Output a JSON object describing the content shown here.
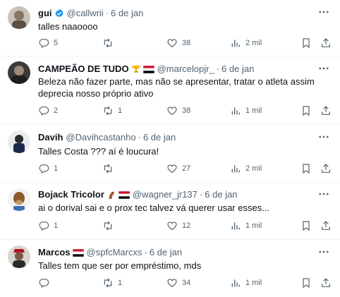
{
  "tweets": [
    {
      "name": "gui",
      "verified": true,
      "handle": "@callwrii",
      "sep": "·",
      "time": "6 de jan",
      "text": "talles naaoooo",
      "replies": "5",
      "retweets": "",
      "likes": "38",
      "views": "2 mil"
    },
    {
      "name": "CAMPEÃO DE TUDO",
      "emojis": [
        "trophy-emoji",
        "flag-emoji"
      ],
      "handle": "@marcelopjr_",
      "sep": "·",
      "time": "6 de jan",
      "text": "Beleza não fazer parte, mas não se apresentar, tratar o atleta assim deprecia nosso próprio ativo",
      "replies": "2",
      "retweets": "1",
      "likes": "38",
      "views": "1 mil"
    },
    {
      "name": "Davih",
      "handle": "@Davihcastanho",
      "sep": "·",
      "time": "6 de jan",
      "text": "Talles Costa ??? aí é loucura!",
      "replies": "1",
      "retweets": "",
      "likes": "27",
      "views": "2 mil"
    },
    {
      "name": "Bojack Tricolor",
      "emojis": [
        "horse-emoji",
        "flag-emoji"
      ],
      "handle": "@wagner_jr137",
      "sep": "·",
      "time": "6 de jan",
      "text": "ai o dorival sai e o prox tec talvez vá querer usar esses...",
      "replies": "1",
      "retweets": "",
      "likes": "12",
      "views": "1 mil"
    },
    {
      "name": "Marcos",
      "emojis": [
        "flag-emoji"
      ],
      "handle": "@spfcMarcxs",
      "sep": "·",
      "time": "6 de jan",
      "text": "Talles tem que ser por empréstimo, mds",
      "replies": "",
      "retweets": "1",
      "likes": "34",
      "views": "1 mil"
    }
  ],
  "icons": {
    "reply": "reply-icon",
    "retweet": "retweet-icon",
    "like": "heart-icon",
    "views": "views-icon",
    "bookmark": "bookmark-icon",
    "share": "share-icon",
    "more": "more-icon",
    "verified": "verified-badge-icon"
  },
  "colors": {
    "text": "#0f1419",
    "secondary": "#536471",
    "verified": "#1d9bf0",
    "divider": "#eff3f4"
  }
}
